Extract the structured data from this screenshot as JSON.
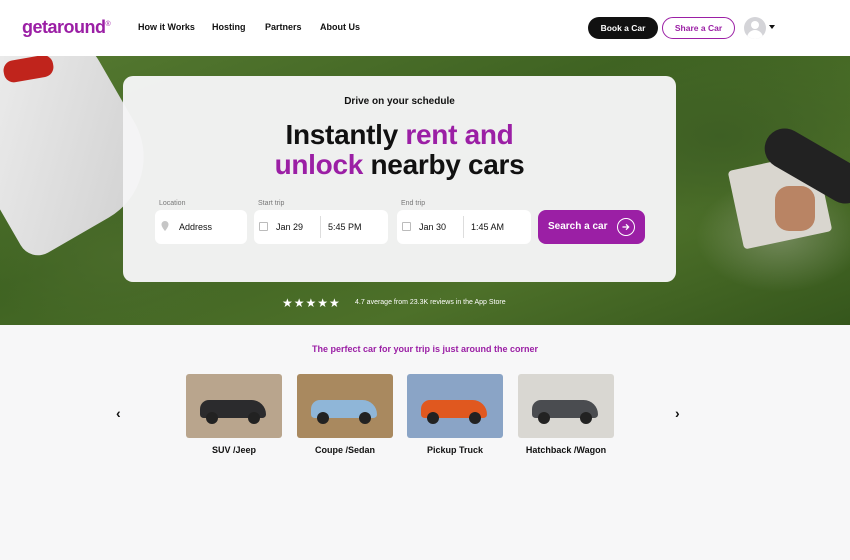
{
  "header": {
    "logo": "getaround",
    "logo_mark": "®",
    "nav": [
      "How it Works",
      "Hosting",
      "Partners",
      "About Us"
    ],
    "book_label": "Book a Car",
    "share_label": "Share a Car"
  },
  "hero": {
    "tagline": "Drive on your schedule",
    "headline": {
      "part1": "Instantly ",
      "accent1": "rent and",
      "accent2": "unlock",
      "part2": " nearby cars"
    },
    "search": {
      "location_label": "Location",
      "location_placeholder": "Address",
      "start_label": "Start trip",
      "start_date": "Jan 29",
      "start_time": "5:45 PM",
      "end_label": "End trip",
      "end_date": "Jan 30",
      "end_time": "1:45 AM",
      "button_label": "Search a car"
    },
    "rating": {
      "stars": "★★★★★",
      "value": 4.7,
      "text": "4.7 average from 23.3K reviews in the App Store"
    }
  },
  "categories": {
    "title": "The perfect car for your trip is just around the corner",
    "items": [
      {
        "label": "SUV /Jeep",
        "car_color": "#2b2b2d",
        "bg": "#b9a58d"
      },
      {
        "label": "Coupe /Sedan",
        "car_color": "#8fb6d8",
        "bg": "#a9895f"
      },
      {
        "label": "Pickup Truck",
        "car_color": "#e0581f",
        "bg": "#8aa4c6"
      },
      {
        "label": "Hatchback /Wagon",
        "car_color": "#4a4c50",
        "bg": "#d9d7d2"
      }
    ]
  },
  "colors": {
    "brand": "#9b1fa5",
    "dark": "#111111"
  }
}
